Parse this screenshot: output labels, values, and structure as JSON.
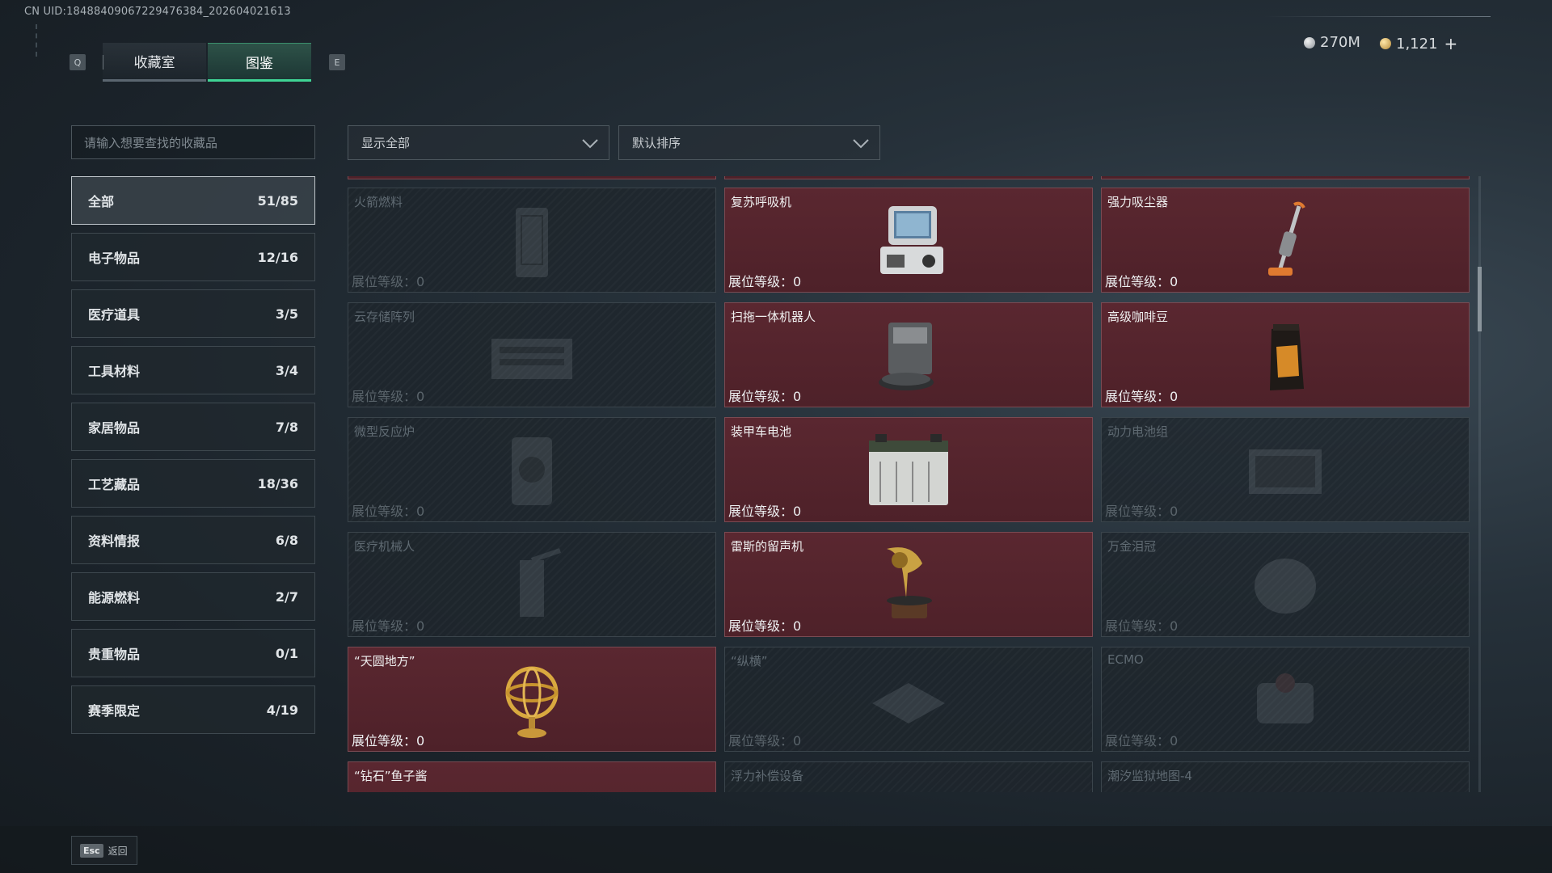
{
  "uid": "CN UID:18488409067229476384_202604021613",
  "tabs": {
    "prev_key": "Q",
    "next_key": "E",
    "tab1": "收藏室",
    "tab2": "图鉴"
  },
  "currency": {
    "silver": "270M",
    "gold": "1,121",
    "plus": "+"
  },
  "search": {
    "placeholder": "请输入想要查找的收藏品"
  },
  "filters": {
    "filter": "显示全部",
    "sort": "默认排序"
  },
  "categories": [
    {
      "label": "全部",
      "count": "51/85"
    },
    {
      "label": "电子物品",
      "count": "12/16"
    },
    {
      "label": "医疗道具",
      "count": "3/5"
    },
    {
      "label": "工具材料",
      "count": "3/4"
    },
    {
      "label": "家居物品",
      "count": "7/8"
    },
    {
      "label": "工艺藏品",
      "count": "18/36"
    },
    {
      "label": "资料情报",
      "count": "6/8"
    },
    {
      "label": "能源燃料",
      "count": "2/7"
    },
    {
      "label": "贵重物品",
      "count": "0/1"
    },
    {
      "label": "赛季限定",
      "count": "4/19"
    }
  ],
  "level_label": "展位等级：0",
  "items": [
    {
      "name": "火箭燃料",
      "owned": false,
      "icon": "canister-icon"
    },
    {
      "name": "复苏呼吸机",
      "owned": true,
      "icon": "ventilator-icon"
    },
    {
      "name": "强力吸尘器",
      "owned": true,
      "icon": "vacuum-icon"
    },
    {
      "name": "云存储阵列",
      "owned": false,
      "icon": "server-icon"
    },
    {
      "name": "扫拖一体机器人",
      "owned": true,
      "icon": "robot-mop-icon"
    },
    {
      "name": "高级咖啡豆",
      "owned": true,
      "icon": "coffee-bag-icon"
    },
    {
      "name": "微型反应炉",
      "owned": false,
      "icon": "reactor-icon"
    },
    {
      "name": "装甲车电池",
      "owned": true,
      "icon": "battery-icon"
    },
    {
      "name": "动力电池组",
      "owned": false,
      "icon": "battery-pack-icon"
    },
    {
      "name": "医疗机械人",
      "owned": false,
      "icon": "medical-robot-icon"
    },
    {
      "name": "雷斯的留声机",
      "owned": true,
      "icon": "gramophone-icon"
    },
    {
      "name": "万金泪冠",
      "owned": false,
      "icon": "crown-icon"
    },
    {
      "name": "“天圆地方”",
      "owned": true,
      "icon": "armillary-icon"
    },
    {
      "name": "“纵横”",
      "owned": false,
      "icon": "chessboard-icon"
    },
    {
      "name": "ECMO",
      "owned": false,
      "icon": "ecmo-icon"
    },
    {
      "name": "“钻石”鱼子酱",
      "owned": true,
      "icon": "caviar-icon"
    },
    {
      "name": "浮力补偿设备",
      "owned": false,
      "icon": "bcd-icon"
    },
    {
      "name": "潮汐监狱地图-4",
      "owned": false,
      "icon": "map-icon"
    }
  ],
  "back": {
    "key": "Esc",
    "label": "返回"
  }
}
